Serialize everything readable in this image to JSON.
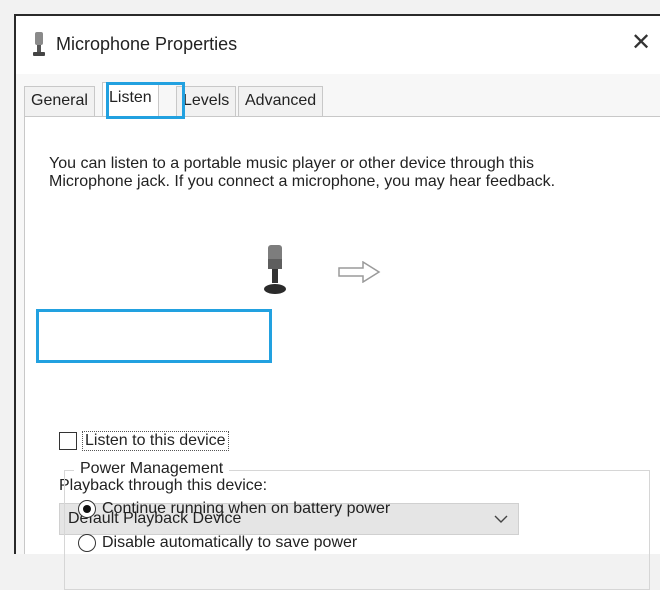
{
  "window": {
    "title": "Microphone Properties",
    "close_glyph": "✕"
  },
  "tabs": [
    {
      "label": "General",
      "active": false
    },
    {
      "label": "Listen",
      "active": true
    },
    {
      "label": "Levels",
      "active": false
    },
    {
      "label": "Advanced",
      "active": false
    }
  ],
  "listen": {
    "description": "You can listen to a portable music player or other device through this Microphone jack.  If you connect a microphone, you may hear feedback.",
    "listen_checkbox_label": "Listen to this device",
    "listen_checked": false,
    "playback_label": "Playback through this device:",
    "playback_selected": "Default Playback Device",
    "power_group_title": "Power Management",
    "power_options": [
      {
        "label": "Continue running when on battery power",
        "selected": true
      },
      {
        "label": "Disable automatically to save power",
        "selected": false
      }
    ]
  },
  "icons": {
    "title": "microphone-icon",
    "mic": "microphone-icon",
    "arrow": "arrow-right-icon",
    "chevron": "chevron-down-icon"
  },
  "colors": {
    "highlight": "#22a1e0"
  }
}
